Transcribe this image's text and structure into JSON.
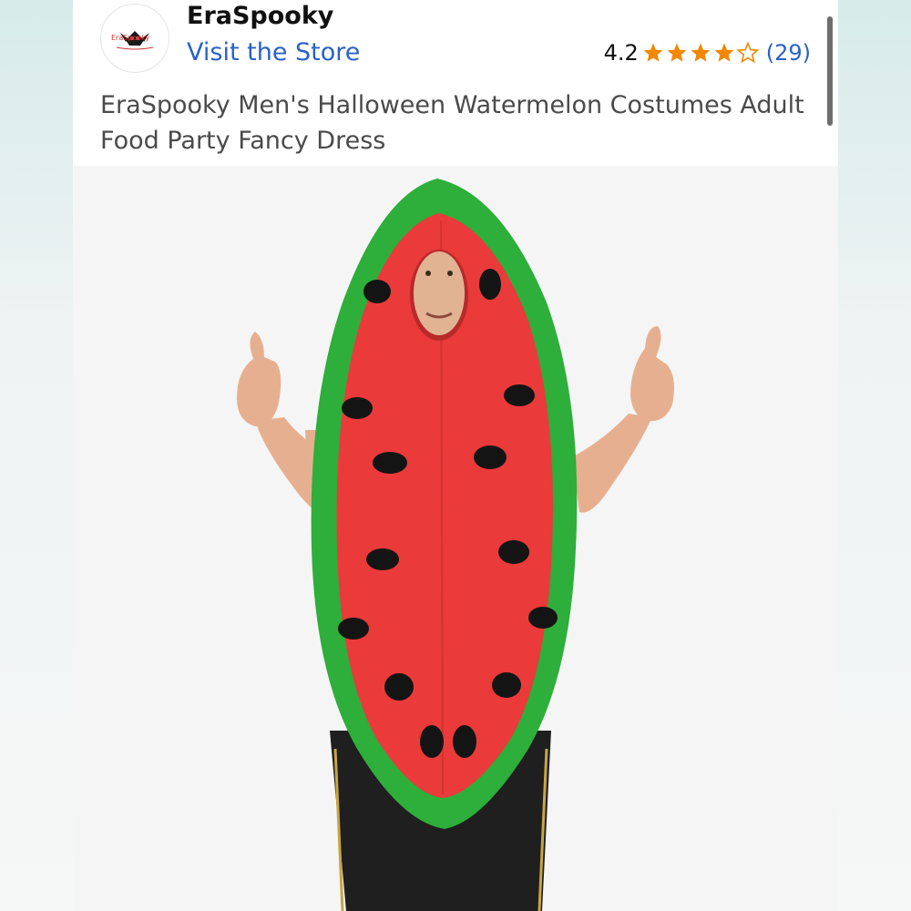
{
  "seller": {
    "name": "EraSpooky",
    "store_link": "Visit the Store",
    "logo_text": "EraSpooky"
  },
  "rating": {
    "value": "4.2",
    "stars": 4.2,
    "review_count": "(29)",
    "star_color": "#f08804"
  },
  "product": {
    "title": "EraSpooky Men's Halloween Watermelon Costumes Adult Food Party Fancy Dress"
  },
  "colors": {
    "link": "#2a62c8",
    "rind": "#2eae3a",
    "flesh": "#ea3a3a"
  }
}
